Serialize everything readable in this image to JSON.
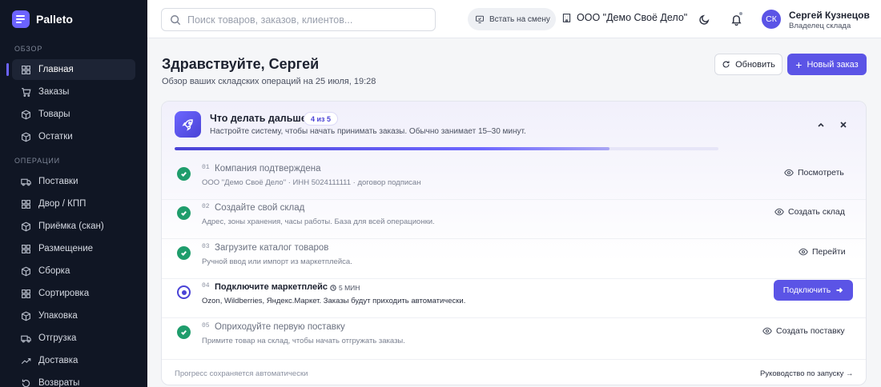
{
  "brand": {
    "name": "Palleto"
  },
  "sidebar": {
    "sections": [
      {
        "label": "ОБЗОР",
        "items": [
          {
            "label": "Главная",
            "icon": "grid-icon",
            "active": true
          },
          {
            "label": "Заказы",
            "icon": "cart-icon"
          },
          {
            "label": "Товары",
            "icon": "box-icon"
          },
          {
            "label": "Остатки",
            "icon": "box-icon"
          }
        ]
      },
      {
        "label": "ОПЕРАЦИИ",
        "items": [
          {
            "label": "Поставки",
            "icon": "truck-icon"
          },
          {
            "label": "Двор / КПП",
            "icon": "grid-icon"
          },
          {
            "label": "Приёмка (скан)",
            "icon": "box-icon"
          },
          {
            "label": "Размещение",
            "icon": "grid-icon"
          },
          {
            "label": "Сборка",
            "icon": "box-icon"
          },
          {
            "label": "Сортировка",
            "icon": "grid-icon"
          },
          {
            "label": "Упаковка",
            "icon": "box-icon"
          },
          {
            "label": "Отгрузка",
            "icon": "truck-icon"
          },
          {
            "label": "Доставка",
            "icon": "trend-icon"
          },
          {
            "label": "Возвраты",
            "icon": "return-icon"
          }
        ]
      }
    ]
  },
  "topbar": {
    "search_placeholder": "Поиск товаров, заказов, клиентов...",
    "shift_label": "Встать на смену",
    "company": "ООО \"Демо Своё Дело\"",
    "user": {
      "initials": "СК",
      "name": "Сергей Кузнецов",
      "role": "Владелец склада"
    }
  },
  "main": {
    "greeting": "Здравствуйте, Сергей",
    "subtitle": "Обзор ваших складских операций на 25 июля, 19:28",
    "refresh_label": "Обновить",
    "new_order_label": "Новый заказ"
  },
  "onboarding": {
    "title": "Что делать дальше",
    "badge": "4 из 5",
    "description": "Настройте систему, чтобы начать принимать заказы. Обычно занимает 15–30 минут.",
    "progress": 0.8,
    "steps": [
      {
        "num": "01",
        "title": "Компания подтверждена",
        "sub": "ООО \"Демо Своё Дело\" · ИНН 5024111111 · договор подписан",
        "action": "Посмотреть",
        "done": true
      },
      {
        "num": "02",
        "title": "Создайте свой склад",
        "sub": "Адрес, зоны хранения, часы работы. База для всей операционки.",
        "action": "Создать склад",
        "done": true
      },
      {
        "num": "03",
        "title": "Загрузите каталог товаров",
        "sub": "Ручной ввод или импорт из маркетплейса.",
        "action": "Перейти",
        "done": true
      },
      {
        "num": "04",
        "title": "Подключите маркетплейс",
        "time": "5 МИН",
        "sub": "Ozon, Wildberries, Яндекс.Маркет. Заказы будут приходить автоматически.",
        "action": "Подключить",
        "done": false,
        "current": true
      },
      {
        "num": "05",
        "title": "Оприходуйте первую поставку",
        "sub": "Примите товар на склад, чтобы начать отгружать заказы.",
        "action": "Создать поставку",
        "done": true
      }
    ],
    "footer_left": "Прогресс сохраняется автоматически",
    "footer_right": "Руководство по запуску →"
  },
  "colors": {
    "accent": "#5b54e6",
    "success": "#1f9d6c",
    "sidebar_bg": "#101624"
  }
}
